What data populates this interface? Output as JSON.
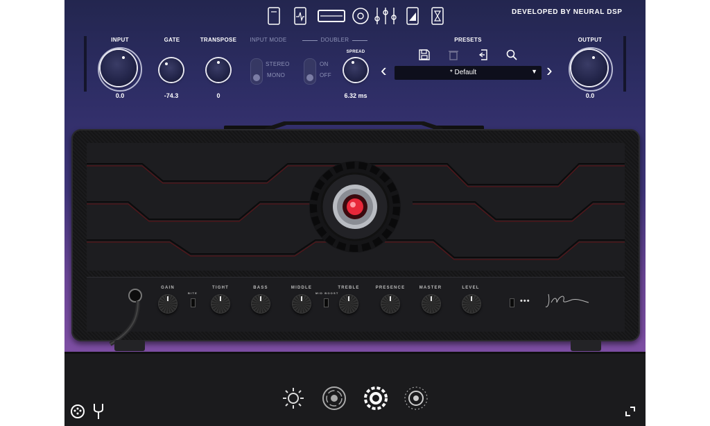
{
  "brand": {
    "credit": "DEVELOPED BY NEURAL DSP"
  },
  "toolbar": {
    "icons": [
      "tuner-device-icon",
      "pulse-module-icon",
      "amp-head-icon",
      "cabinet-speaker-icon",
      "eq-sliders-icon",
      "signal-ramp-icon",
      "hourglass-icon"
    ],
    "active": "amp-head-icon"
  },
  "top_controls": {
    "input": {
      "label": "INPUT",
      "value": "0.0"
    },
    "gate": {
      "label": "GATE",
      "value": "-74.3"
    },
    "transpose": {
      "label": "TRANSPOSE",
      "value": "0"
    },
    "input_mode": {
      "label": "INPUT MODE",
      "options": [
        "STEREO",
        "MONO"
      ],
      "selected": "MONO"
    },
    "doubler": {
      "label": "DOUBLER",
      "options": [
        "ON",
        "OFF"
      ],
      "selected": "OFF"
    },
    "spread": {
      "label": "SPREAD",
      "value": "6.32 ms"
    },
    "output": {
      "label": "OUTPUT",
      "value": "0.0"
    }
  },
  "presets": {
    "label": "PRESETS",
    "current": "* Default",
    "actions": [
      "save-icon",
      "trash-icon",
      "import-icon",
      "search-icon"
    ],
    "prev_glyph": "‹",
    "next_glyph": "›",
    "caret": "▼"
  },
  "amp": {
    "controls": [
      {
        "id": "gain",
        "label": "GAIN"
      },
      {
        "id": "tight",
        "label": "TIGHT"
      },
      {
        "id": "bass",
        "label": "BASS"
      },
      {
        "id": "middle",
        "label": "MIDDLE"
      },
      {
        "id": "treble",
        "label": "TREBLE"
      },
      {
        "id": "presence",
        "label": "PRESENCE"
      },
      {
        "id": "master",
        "label": "MASTER"
      },
      {
        "id": "level",
        "label": "LEVEL"
      }
    ],
    "switches": [
      {
        "id": "bite",
        "label": "BITE"
      },
      {
        "id": "mid_boost",
        "label": "MID BOOST"
      }
    ],
    "dots": "•••"
  },
  "bottom_bar": {
    "icons": [
      "sun-fx-icon",
      "delay-circle-icon",
      "gear-fx-icon",
      "reverb-knob-icon"
    ],
    "active": "gear-fx-icon"
  },
  "colors": {
    "accent": "#ffffff",
    "led": "#e8283a",
    "bg_top": "#23264f",
    "bg_bottom": "#7d4ea3"
  }
}
